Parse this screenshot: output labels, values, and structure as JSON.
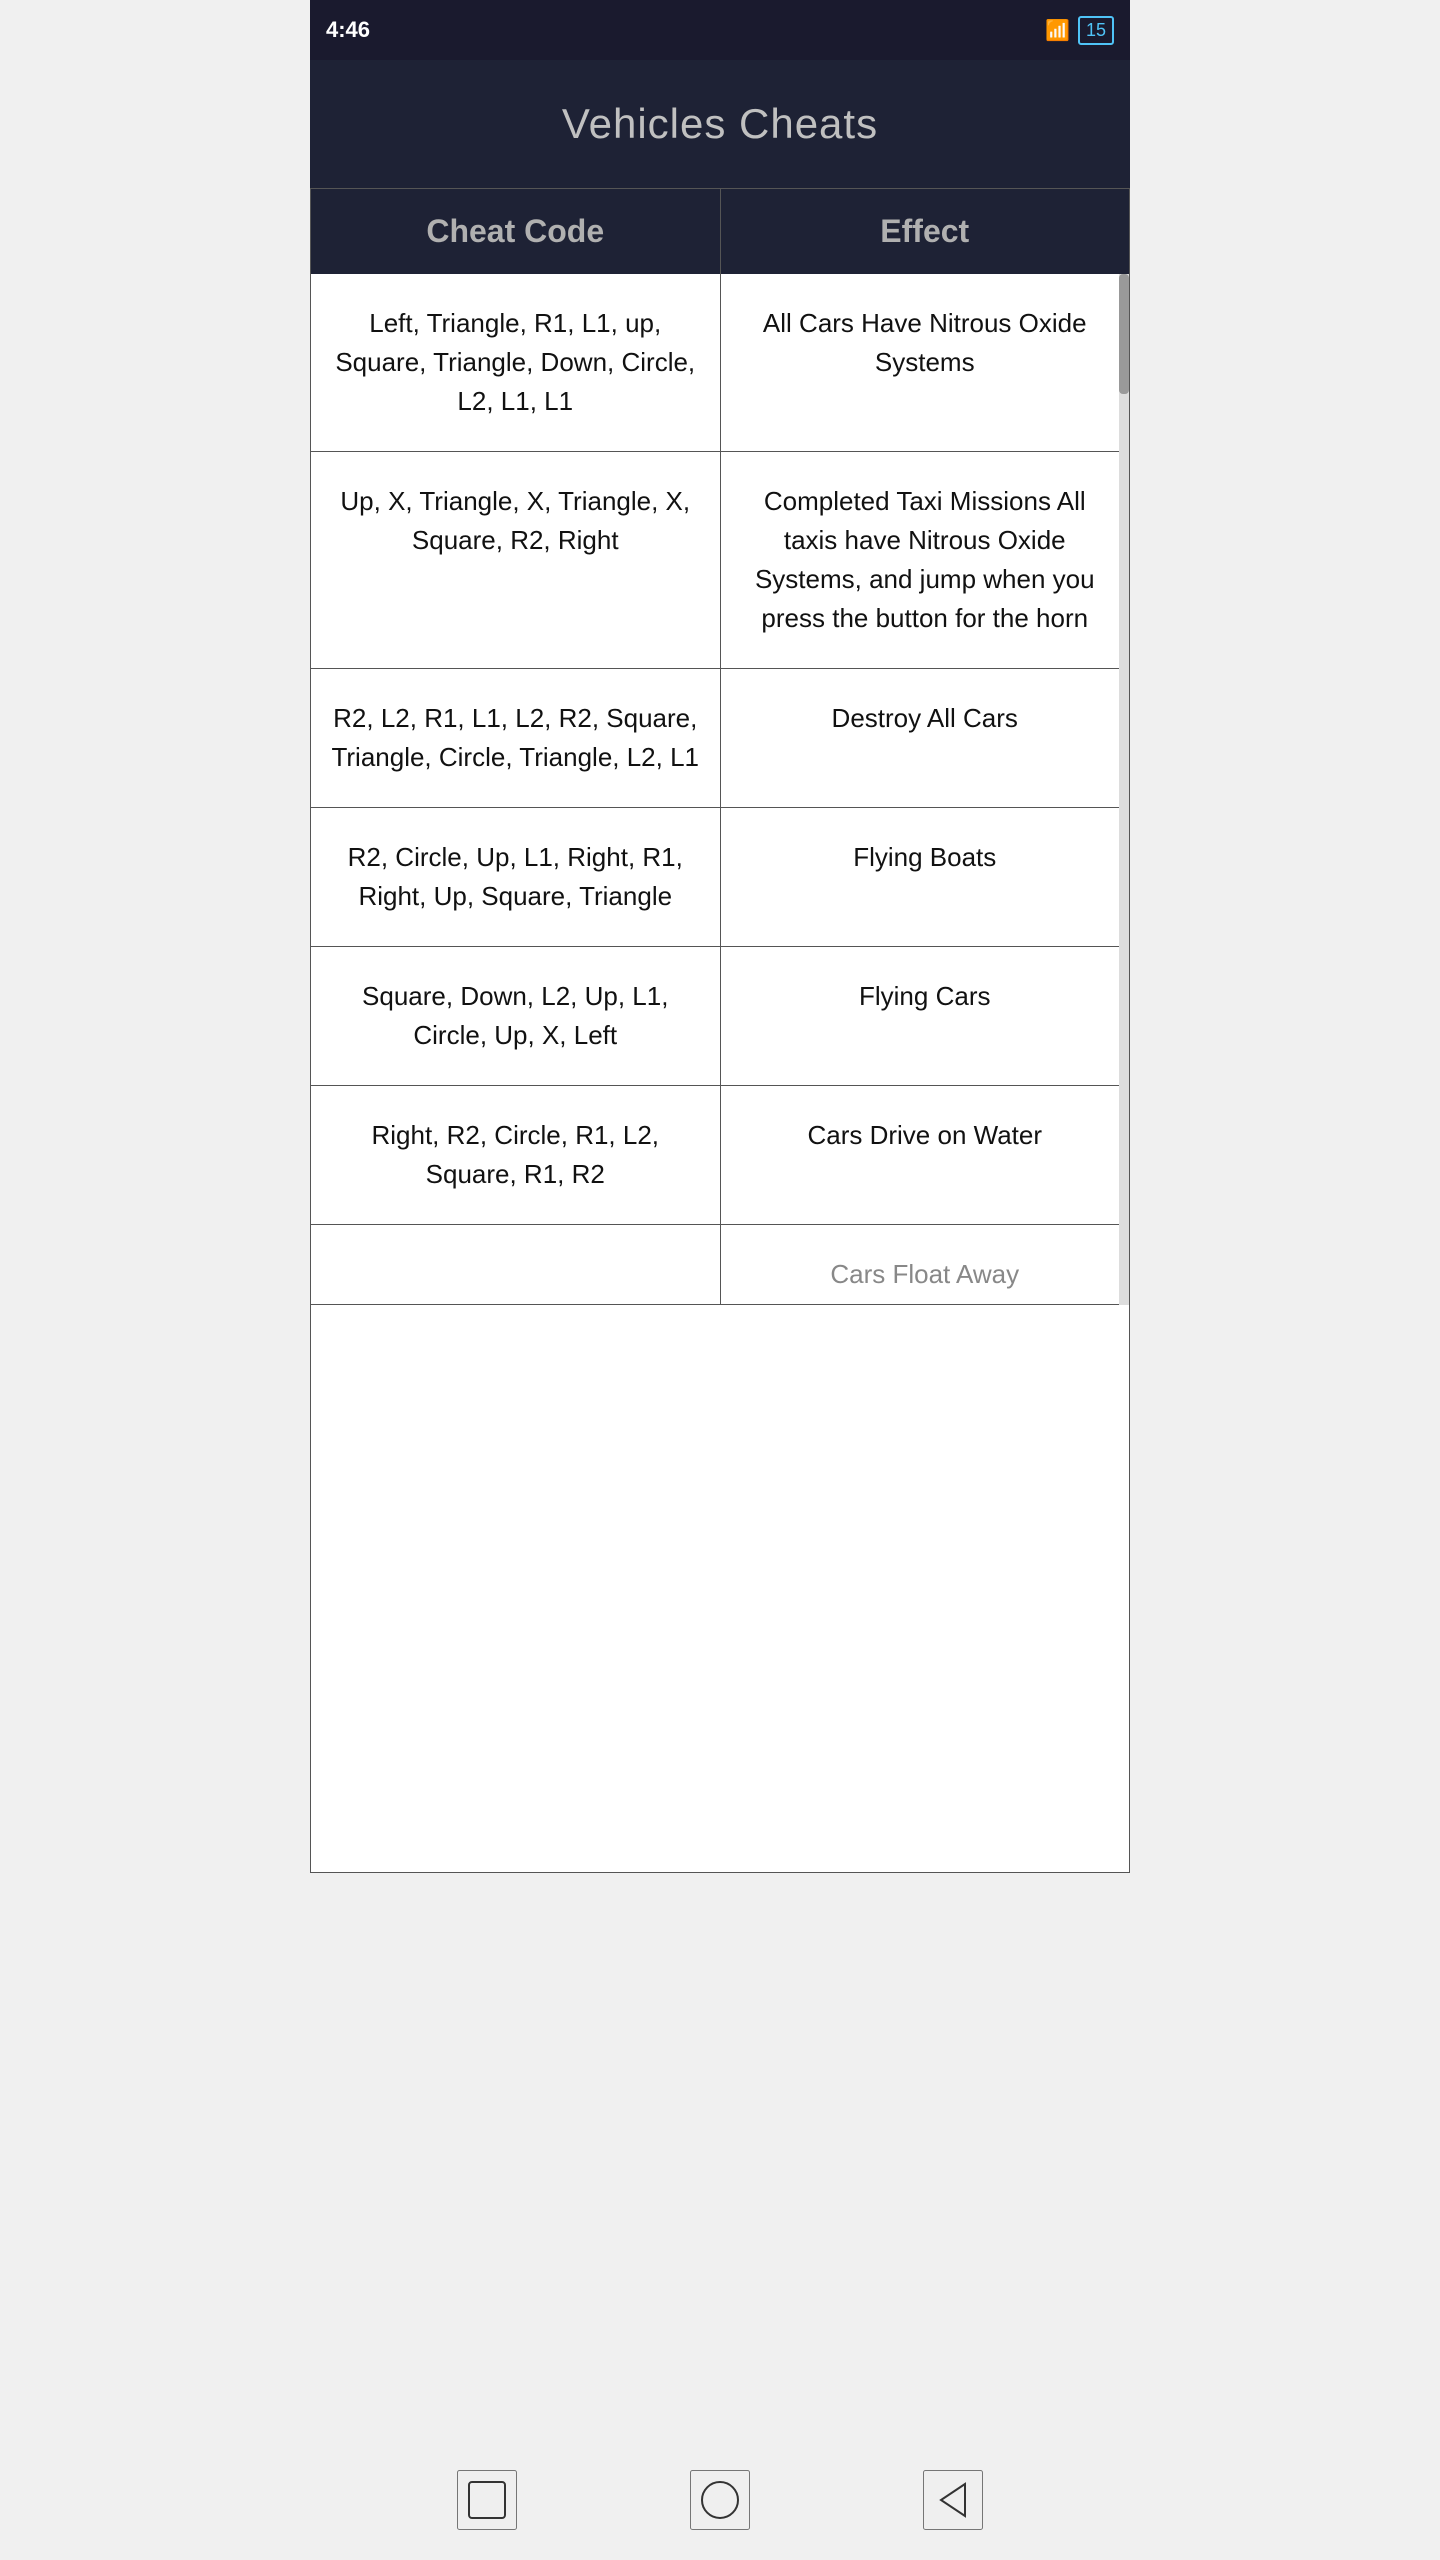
{
  "statusBar": {
    "time": "4:46",
    "signal1": "3G",
    "battery": "15"
  },
  "pageTitle": "Vehicles Cheats",
  "table": {
    "headers": [
      "Cheat Code",
      "Effect"
    ],
    "rows": [
      {
        "cheatCode": "Left, Triangle, R1, L1, up, Square, Triangle, Down, Circle, L2, L1, L1",
        "effect": "All Cars Have Nitrous Oxide Systems"
      },
      {
        "cheatCode": "Up, X, Triangle, X, Triangle, X, Square, R2, Right",
        "effect": "Completed Taxi Missions All taxis have Nitrous Oxide Systems, and jump when you press the button for the horn"
      },
      {
        "cheatCode": "R2, L2, R1, L1, L2, R2, Square, Triangle, Circle, Triangle, L2, L1",
        "effect": "Destroy All Cars"
      },
      {
        "cheatCode": "R2, Circle, Up, L1, Right, R1, Right, Up, Square, Triangle",
        "effect": "Flying Boats"
      },
      {
        "cheatCode": "Square, Down, L2, Up, L1, Circle, Up, X, Left",
        "effect": "Flying Cars"
      },
      {
        "cheatCode": "Right, R2, Circle, R1, L2, Square, R1, R2",
        "effect": "Cars Drive on Water"
      },
      {
        "cheatCode": "",
        "effect": "Cars Float Away"
      }
    ]
  },
  "navBar": {
    "recentsIcon": "square",
    "homeIcon": "circle",
    "backIcon": "triangle-left"
  }
}
